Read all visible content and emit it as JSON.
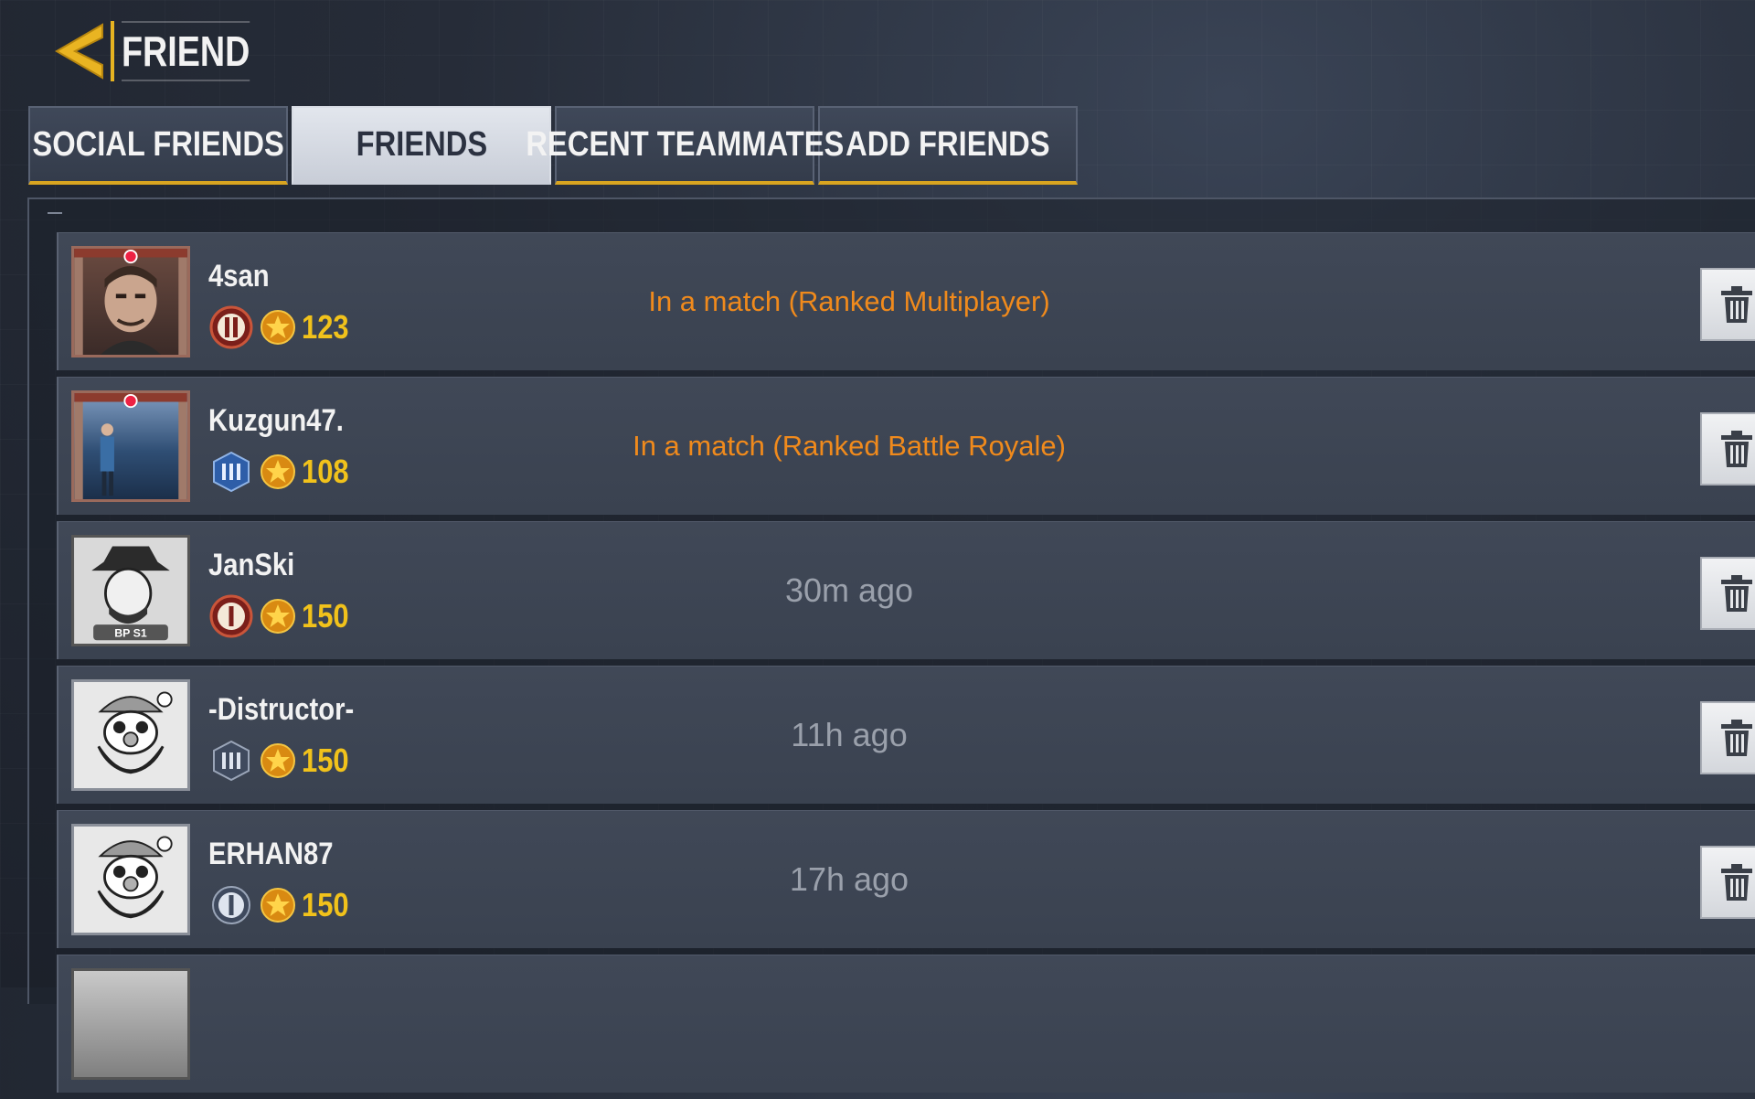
{
  "header": {
    "title": "FRIEND"
  },
  "tabs": [
    {
      "label": "SOCIAL FRIENDS",
      "active": false
    },
    {
      "label": "FRIENDS",
      "active": true
    },
    {
      "label": "RECENT TEAMMATES",
      "active": false
    },
    {
      "label": "ADD FRIENDS",
      "active": false
    }
  ],
  "colors": {
    "accent": "#d9a520",
    "online_status": "#f08a1c",
    "level": "#f1c21b"
  },
  "friends": [
    {
      "name": "4san",
      "level": "123",
      "status": "In a match (Ranked Multiplayer)",
      "status_type": "online",
      "rank_icon": "rank-ii-icon",
      "avatar": "soldier-avatar"
    },
    {
      "name": "Kuzgun47.",
      "level": "108",
      "status": "In a match (Ranked Battle Royale)",
      "status_type": "online",
      "rank_icon": "rank-iii-blue-icon",
      "avatar": "photo-avatar"
    },
    {
      "name": "JanSki",
      "level": "150",
      "status": "30m ago",
      "status_type": "offline",
      "rank_icon": "rank-i-icon",
      "avatar": "hat-man-avatar",
      "avatar_label": "BP S1"
    },
    {
      "name": "-Distructor-",
      "level": "150",
      "status": "11h ago",
      "status_type": "offline",
      "rank_icon": "rank-iii-gray-icon",
      "avatar": "santa-avatar"
    },
    {
      "name": "ERHAN87",
      "level": "150",
      "status": "17h ago",
      "status_type": "offline",
      "rank_icon": "rank-i-gray-icon",
      "avatar": "santa-avatar"
    }
  ]
}
